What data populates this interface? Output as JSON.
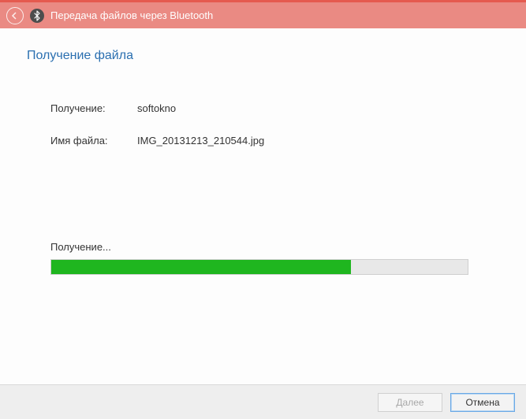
{
  "titlebar": {
    "title": "Передача файлов через Bluetooth"
  },
  "heading": "Получение файла",
  "fields": {
    "receive_label": "Получение:",
    "receive_value": "softokno",
    "filename_label": "Имя файла:",
    "filename_value": "IMG_20131213_210544.jpg"
  },
  "progress": {
    "label": "Получение...",
    "percent": 72
  },
  "buttons": {
    "next": "Далее",
    "cancel": "Отмена"
  }
}
